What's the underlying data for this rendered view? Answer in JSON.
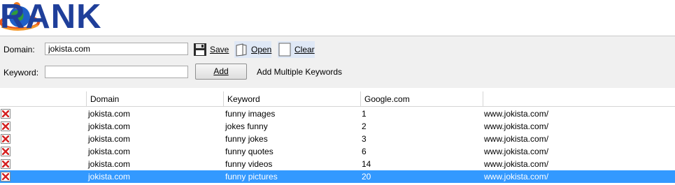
{
  "header": {
    "logo_text": "RANK CHECKER"
  },
  "toolbar": {
    "domain_label": "Domain:",
    "domain_value": "jokista.com",
    "keyword_label": "Keyword:",
    "keyword_value": "",
    "save_label": "Save",
    "open_label": "Open",
    "clear_label": "Clear",
    "add_label": "Add",
    "add_multiple_label": "Add Multiple Keywords"
  },
  "grid": {
    "columns": [
      "",
      "Domain",
      "Keyword",
      "Google.com",
      ""
    ],
    "rows": [
      {
        "domain": "jokista.com",
        "keyword": "funny images",
        "rank": "1",
        "url": "www.jokista.com/"
      },
      {
        "domain": "jokista.com",
        "keyword": "jokes funny",
        "rank": "2",
        "url": "www.jokista.com/"
      },
      {
        "domain": "jokista.com",
        "keyword": "funny jokes",
        "rank": "3",
        "url": "www.jokista.com/"
      },
      {
        "domain": "jokista.com",
        "keyword": "funny quotes",
        "rank": "6",
        "url": "www.jokista.com/"
      },
      {
        "domain": "jokista.com",
        "keyword": "funny videos",
        "rank": "14",
        "url": "www.jokista.com/"
      },
      {
        "domain": "jokista.com",
        "keyword": "funny pictures",
        "rank": "20",
        "url": "www.jokista.com/"
      }
    ],
    "selected_row": 5
  },
  "icons": {
    "save": "floppy-disk-icon",
    "open": "open-document-icon",
    "clear": "blank-page-icon",
    "delete": "red-x-icon"
  },
  "colors": {
    "logo": "#1f3f9a",
    "selection": "#3399ff",
    "delete_x": "#d42020"
  }
}
